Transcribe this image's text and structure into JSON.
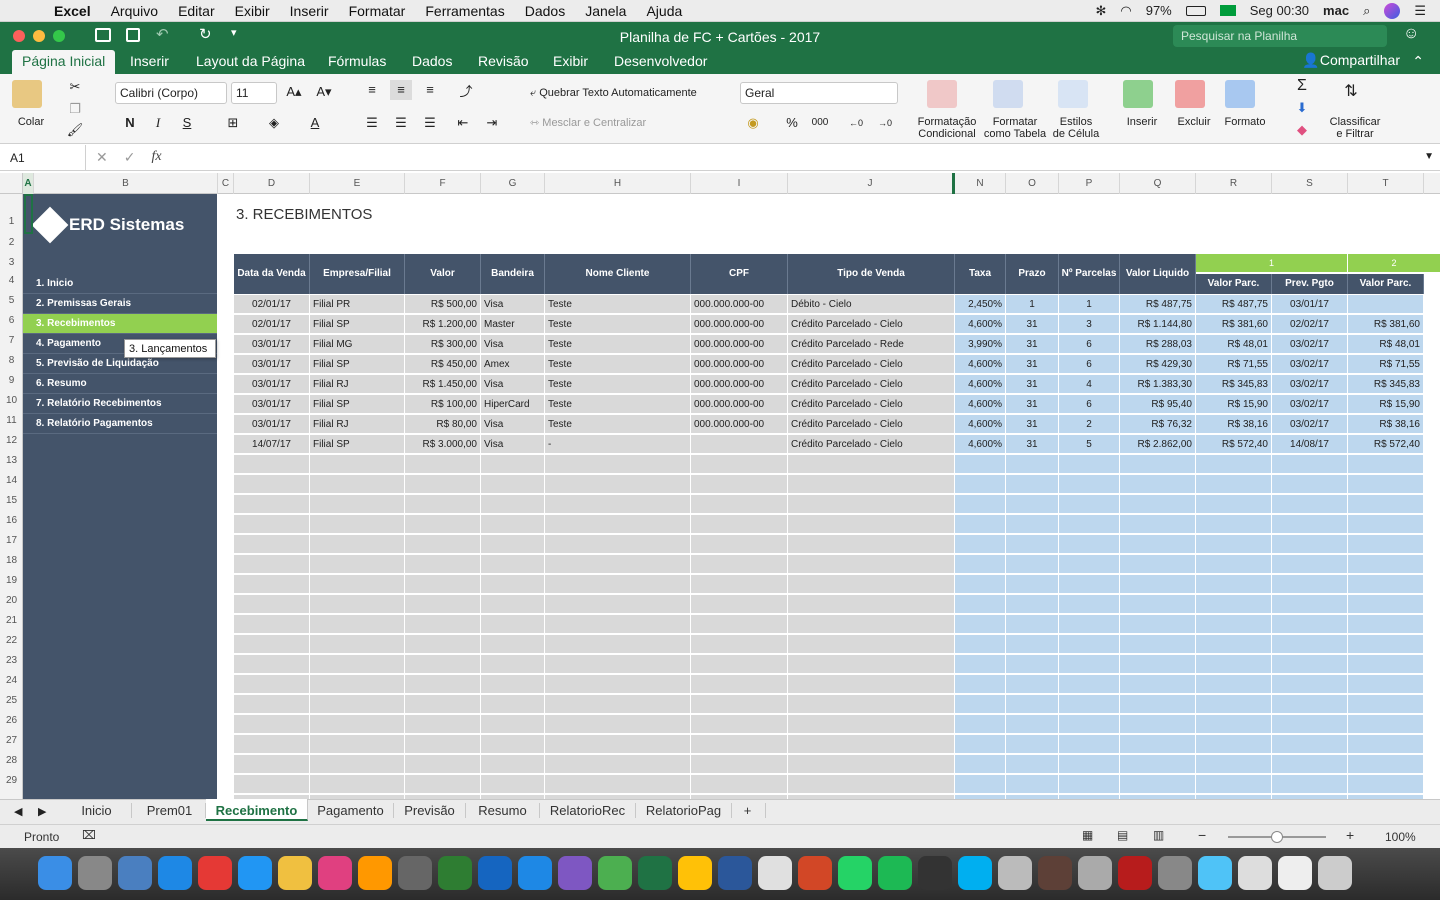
{
  "menubar": {
    "app": "Excel",
    "items": [
      "Arquivo",
      "Editar",
      "Exibir",
      "Inserir",
      "Formatar",
      "Ferramentas",
      "Dados",
      "Janela",
      "Ajuda"
    ],
    "battery": "97%",
    "clock": "Seg 00:30",
    "user": "mac"
  },
  "title": {
    "doc": "Planilha de FC + Cartões - 2017",
    "search_placeholder": "Pesquisar na Planilha"
  },
  "ribbon_tabs": [
    "Página Inicial",
    "Inserir",
    "Layout da Página",
    "Fórmulas",
    "Dados",
    "Revisão",
    "Exibir",
    "Desenvolvedor"
  ],
  "share": "Compartilhar",
  "ribbon": {
    "paste": "Colar",
    "font": "Calibri (Corpo)",
    "size": "11",
    "bold": "N",
    "italic": "I",
    "underline": "S",
    "wrap": "Quebrar Texto Automaticamente",
    "merge": "Mesclar e Centralizar",
    "numfmt": "Geral",
    "percent": "%",
    "thousands": "000",
    "cond_fmt_1": "Formatação",
    "cond_fmt_2": "Condicional",
    "fmt_table_1": "Formatar",
    "fmt_table_2": "como Tabela",
    "styles_1": "Estilos",
    "styles_2": "de Célula",
    "insert": "Inserir",
    "delete": "Excluir",
    "format": "Formato",
    "sort_1": "Classificar",
    "sort_2": "e Filtrar"
  },
  "namebox": "A1",
  "fx": "fx",
  "columns": [
    "A",
    "B",
    "C",
    "D",
    "E",
    "F",
    "G",
    "H",
    "I",
    "J",
    "N",
    "O",
    "P",
    "Q",
    "R",
    "S",
    "T"
  ],
  "rows": [
    "1",
    "2",
    "3",
    "4",
    "5",
    "6",
    "7",
    "8",
    "9",
    "10",
    "11",
    "12",
    "13",
    "14",
    "15",
    "16",
    "17",
    "18",
    "19",
    "20",
    "21",
    "22",
    "23",
    "24",
    "25",
    "26",
    "27",
    "28",
    "29"
  ],
  "sidebar": {
    "logo": "ERD Sistemas",
    "items": [
      "1. Inicio",
      "2. Premissas Gerais",
      "3. Recebimentos",
      "4. Pagamento",
      "5. Previsão de Liquidação",
      "6. Resumo",
      "7. Relatório Recebimentos",
      "8. Relatório Pagamentos"
    ],
    "tooltip": "3. Lançamentos"
  },
  "sheet_title": "3. RECEBIMENTOS",
  "headers": [
    "Data da Venda",
    "Empresa/Filial",
    "Valor",
    "Bandeira",
    "Nome Cliente",
    "CPF",
    "Tipo de Venda",
    "Taxa",
    "Prazo",
    "Nº Parcelas",
    "Valor Liquido"
  ],
  "groups": [
    {
      "label": "1",
      "cols": [
        "Valor Parc.",
        "Prev. Pgto"
      ]
    },
    {
      "label": "2",
      "cols": [
        "Valor Parc."
      ]
    }
  ],
  "table": [
    [
      "02/01/17",
      "Filial PR",
      "R$ 500,00",
      "Visa",
      "Teste",
      "000.000.000-00",
      "Débito - Cielo",
      "2,450%",
      "1",
      "1",
      "R$ 487,75",
      "R$ 487,75",
      "03/01/17",
      ""
    ],
    [
      "02/01/17",
      "Filial SP",
      "R$ 1.200,00",
      "Master",
      "Teste",
      "000.000.000-00",
      "Crédito Parcelado - Cielo",
      "4,600%",
      "31",
      "3",
      "R$ 1.144,80",
      "R$ 381,60",
      "02/02/17",
      "R$ 381,60"
    ],
    [
      "03/01/17",
      "Filial MG",
      "R$ 300,00",
      "Visa",
      "Teste",
      "000.000.000-00",
      "Crédito Parcelado - Rede",
      "3,990%",
      "31",
      "6",
      "R$ 288,03",
      "R$ 48,01",
      "03/02/17",
      "R$ 48,01"
    ],
    [
      "03/01/17",
      "Filial SP",
      "R$ 450,00",
      "Amex",
      "Teste",
      "000.000.000-00",
      "Crédito Parcelado - Cielo",
      "4,600%",
      "31",
      "6",
      "R$ 429,30",
      "R$ 71,55",
      "03/02/17",
      "R$ 71,55"
    ],
    [
      "03/01/17",
      "Filial RJ",
      "R$ 1.450,00",
      "Visa",
      "Teste",
      "000.000.000-00",
      "Crédito Parcelado - Cielo",
      "4,600%",
      "31",
      "4",
      "R$ 1.383,30",
      "R$ 345,83",
      "03/02/17",
      "R$ 345,83"
    ],
    [
      "03/01/17",
      "Filial SP",
      "R$ 100,00",
      "HiperCard",
      "Teste",
      "000.000.000-00",
      "Crédito Parcelado - Cielo",
      "4,600%",
      "31",
      "6",
      "R$ 95,40",
      "R$ 15,90",
      "03/02/17",
      "R$ 15,90"
    ],
    [
      "03/01/17",
      "Filial RJ",
      "R$ 80,00",
      "Visa",
      "Teste",
      "000.000.000-00",
      "Crédito Parcelado - Cielo",
      "4,600%",
      "31",
      "2",
      "R$ 76,32",
      "R$ 38,16",
      "03/02/17",
      "R$ 38,16"
    ],
    [
      "14/07/17",
      "Filial SP",
      "R$ 3.000,00",
      "Visa",
      "-",
      "",
      "Crédito Parcelado - Cielo",
      "4,600%",
      "31",
      "5",
      "R$ 2.862,00",
      "R$ 572,40",
      "14/08/17",
      "R$ 572,40"
    ]
  ],
  "sheet_tabs": [
    "Inicio",
    "Prem01",
    "Recebimento",
    "Pagamento",
    "Previsão",
    "Resumo",
    "RelatorioRec",
    "RelatorioPag",
    "+"
  ],
  "status": {
    "ready": "Pronto",
    "zoom": "100%"
  },
  "colors": {
    "excel_green": "#1f7244",
    "header": "#44546a",
    "accent_green": "#92d050",
    "light_blue": "#bdd7ee",
    "gray": "#d9d9d9"
  }
}
